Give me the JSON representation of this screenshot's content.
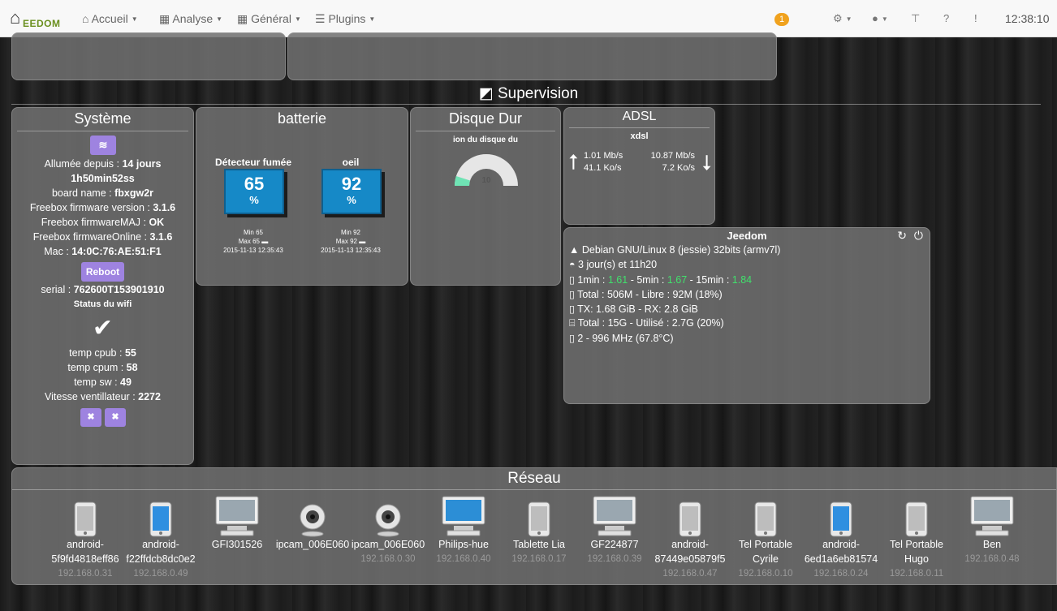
{
  "nav": {
    "logo": "EEDOM",
    "accueil": "Accueil",
    "analyse": "Analyse",
    "general": "Général",
    "plugins": "Plugins",
    "badge": "1",
    "clock": "12:38:10"
  },
  "supervision": {
    "title": "Supervision"
  },
  "systeme": {
    "title": "Système",
    "allumee_label": "Allumée depuis : ",
    "allumee_value": "14 jours",
    "allumee_value2": "1h50min52ss",
    "board_label": "board name : ",
    "board_value": "fbxgw2r",
    "fw_label": "Freebox firmware version : ",
    "fw_value": "3.1.6",
    "fwmaj_label": "Freebox firmwareMAJ : ",
    "fwmaj_value": "OK",
    "fwonline_label": "Freebox firmwareOnline : ",
    "fwonline_value": "3.1.6",
    "mac_label": "Mac : ",
    "mac_value": "14:0C:76:AE:51:F1",
    "reboot": "Reboot",
    "serial_label": "serial : ",
    "serial_value": "762600T153901910",
    "wifi_status": "Status du wifi",
    "cpub_label": "temp cpub : ",
    "cpub_value": "55",
    "cpum_label": "temp cpum : ",
    "cpum_value": "58",
    "sw_label": "temp sw : ",
    "sw_value": "49",
    "fan_label": "Vitesse ventillateur : ",
    "fan_value": "2272"
  },
  "batterie": {
    "title": "batterie",
    "devices": [
      {
        "name": "Détecteur fumée",
        "value": "65",
        "unit": "%",
        "min": "Min 65",
        "max": "Max 65",
        "date": "2015-11-13 12:35:43"
      },
      {
        "name": "oeil",
        "value": "92",
        "unit": "%",
        "min": "Min 92",
        "max": "Max 92",
        "date": "2015-11-13 12:35:43"
      }
    ]
  },
  "disque": {
    "title": "Disque Dur",
    "label": "ion du disque du",
    "value": "10",
    "level": 0.1
  },
  "adsl": {
    "title": "ADSL",
    "sub": "xdsl",
    "up_rate": "1.01 Mb/s",
    "up_speed": "41.1 Ko/s",
    "down_rate": "10.87 Mb/s",
    "down_speed": "7.2 Ko/s"
  },
  "jeedom": {
    "title": "Jeedom",
    "os": "Debian GNU/Linux 8 (jessie) 32bits (armv7l)",
    "uptime": "3 jour(s) et 11h20",
    "load_1_label": "1min : ",
    "load_1": "1.61",
    "load_5_label": " - 5min : ",
    "load_5": "1.67",
    "load_15_label": " - 15min : ",
    "load_15": "1.84",
    "mem": "Total : 506M - Libre : 92M (18%)",
    "net": "TX: 1.68 GiB - RX: 2.8 GiB",
    "disk": "Total : 15G - Utilisé : 2.7G (20%)",
    "cpu": "2 - 996 MHz (67.8°C)"
  },
  "reseau": {
    "title": "Réseau",
    "devices": [
      {
        "icon": "phone-icon",
        "name1": "android-",
        "name2": "5f9fd4818eff86",
        "ip": "192.168.0.31"
      },
      {
        "icon": "phone-blue-icon",
        "name1": "android-",
        "name2": "f22ffdcb8dc0e2",
        "ip": "192.168.0.49"
      },
      {
        "icon": "desktop-icon",
        "name1": "GFI301526",
        "name2": "",
        "ip": ""
      },
      {
        "icon": "webcam-icon",
        "name1": "ipcam_006E060",
        "name2": "",
        "ip": ""
      },
      {
        "icon": "webcam-icon",
        "name1": "ipcam_006E060",
        "name2": "",
        "ip": "192.168.0.30"
      },
      {
        "icon": "desktop-blue-icon",
        "name1": "Philips-hue",
        "name2": "",
        "ip": "192.168.0.40"
      },
      {
        "icon": "phone-icon",
        "name1": "Tablette Lia",
        "name2": "",
        "ip": "192.168.0.17"
      },
      {
        "icon": "desktop-icon",
        "name1": "GF224877",
        "name2": "",
        "ip": "192.168.0.39"
      },
      {
        "icon": "phone-icon",
        "name1": "android-",
        "name2": "87449e05879f5",
        "ip": "192.168.0.47"
      },
      {
        "icon": "phone-icon",
        "name1": "Tel Portable",
        "name2": "Cyrile",
        "ip": "192.168.0.10"
      },
      {
        "icon": "phone-blue-icon",
        "name1": "android-",
        "name2": "6ed1a6eb81574",
        "ip": "192.168.0.24"
      },
      {
        "icon": "phone-icon",
        "name1": "Tel Portable",
        "name2": "Hugo",
        "ip": "192.168.0.11"
      },
      {
        "icon": "desktop-icon",
        "name1": "Ben",
        "name2": "",
        "ip": "192.168.0.48"
      }
    ]
  }
}
